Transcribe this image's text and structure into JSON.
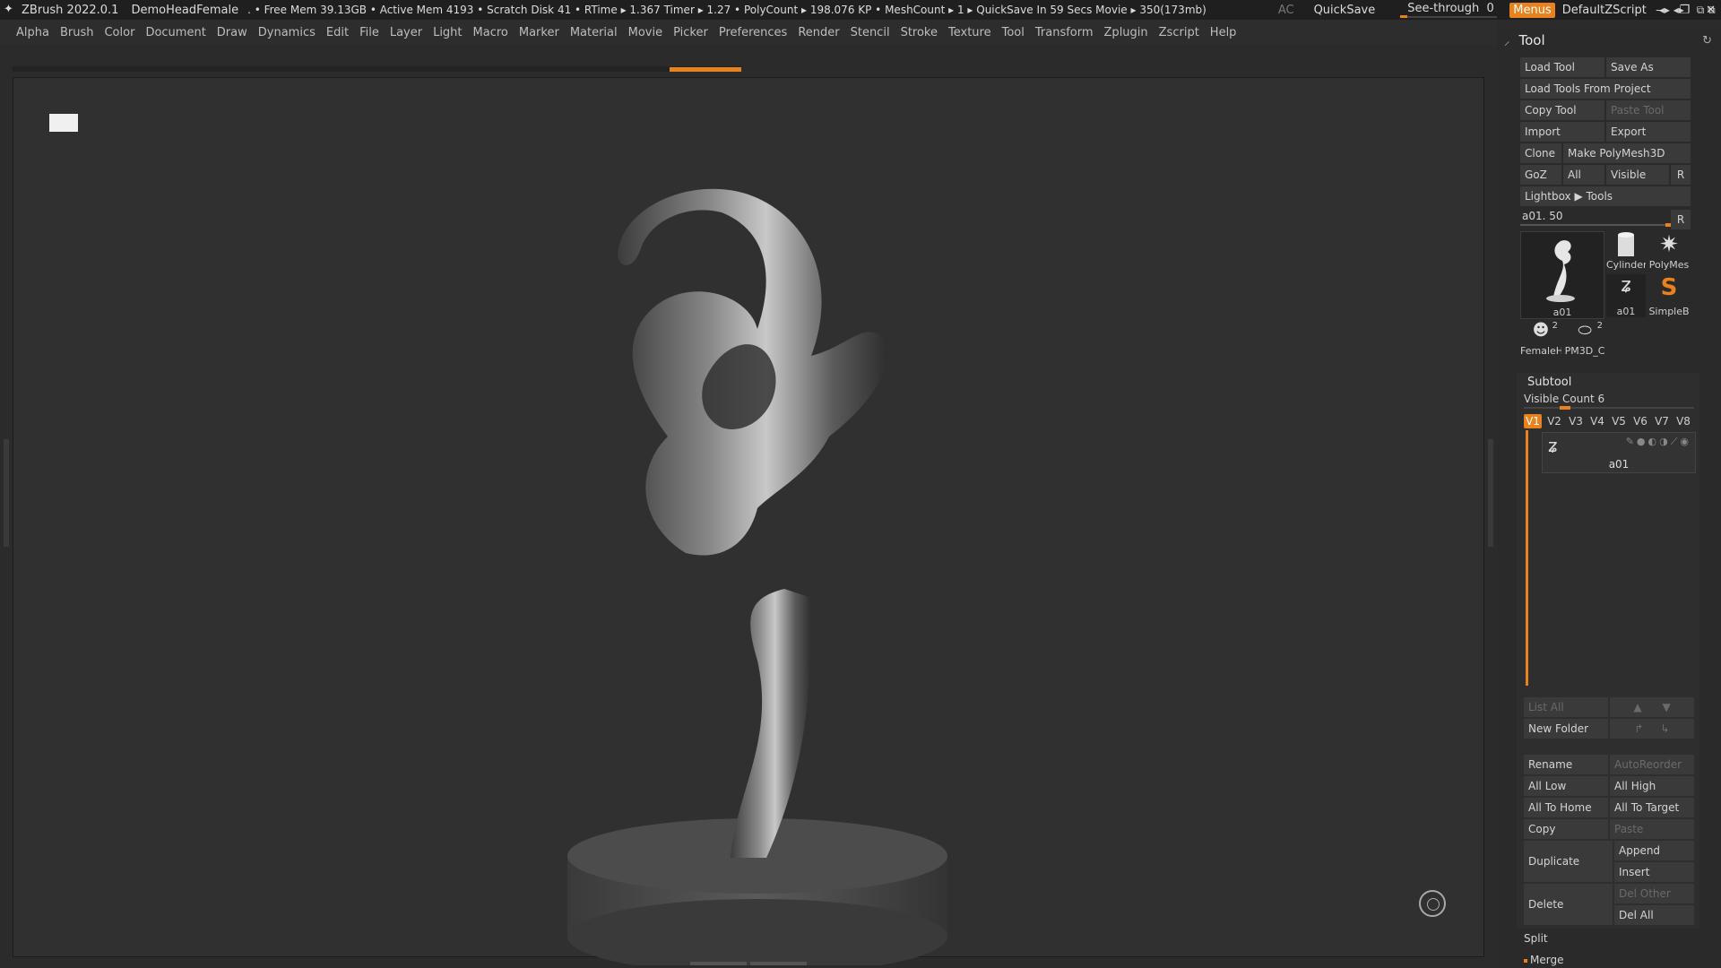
{
  "titlebar": {
    "app": "ZBrush 2022.0.1",
    "document": "DemoHeadFemale",
    "stats": ". • Free Mem 39.13GB • Active Mem 4193 • Scratch Disk 41 •  RTime ▸ 1.367 Timer ▸ 1.27 • PolyCount ▸ 198.076 KP  • MeshCount ▸ 1  ▸ QuickSave In 59 Secs Movie ▸ 350(173mb)",
    "ac": "AC",
    "quicksave": "QuickSave",
    "see_through_label": "See-through",
    "see_through_value": "0",
    "menus": "Menus",
    "default_zscript": "DefaultZScript"
  },
  "menubar": [
    "Alpha",
    "Brush",
    "Color",
    "Document",
    "Draw",
    "Dynamics",
    "Edit",
    "File",
    "Layer",
    "Light",
    "Macro",
    "Marker",
    "Material",
    "Movie",
    "Picker",
    "Preferences",
    "Render",
    "Stencil",
    "Stroke",
    "Texture",
    "Tool",
    "Transform",
    "Zplugin",
    "Zscript",
    "Help"
  ],
  "tool_panel": {
    "title": "Tool",
    "load_tool": "Load Tool",
    "save_as": "Save As",
    "load_from_project": "Load Tools From Project",
    "copy_tool": "Copy Tool",
    "paste_tool": "Paste Tool",
    "import": "Import",
    "export": "Export",
    "clone": "Clone",
    "make_polymesh": "Make PolyMesh3D",
    "goz": "GoZ",
    "all": "All",
    "visible": "Visible",
    "r": "R",
    "lightbox": "Lightbox ▶ Tools",
    "slider_label": "a01. 50",
    "thumbs": {
      "a01_big": "a01",
      "cylinder": "Cylinder",
      "polymesh": "PolyMes",
      "a01_small": "a01",
      "simpleb": "SimpleB",
      "female": "FemaleH",
      "female_count": "2",
      "pm3d": "PM3D_C",
      "pm3d_count": "2"
    }
  },
  "subtool": {
    "title": "Subtool",
    "visible_count": "Visible Count 6",
    "versions": [
      "V1",
      "V2",
      "V3",
      "V4",
      "V5",
      "V6",
      "V7",
      "V8"
    ],
    "item_name": "a01",
    "list_all": "List All",
    "new_folder": "New Folder",
    "rename": "Rename",
    "auto_reorder": "AutoReorder",
    "all_low": "All Low",
    "all_high": "All High",
    "all_to_home": "All To Home",
    "all_to_target": "All To Target",
    "copy": "Copy",
    "paste": "Paste",
    "duplicate": "Duplicate",
    "append": "Append",
    "insert": "Insert",
    "delete": "Delete",
    "del_other": "Del Other",
    "del_all": "Del All",
    "split": "Split",
    "merge": "Merge"
  },
  "icons": [
    "zbrush-logo-icon",
    "brush-icon",
    "refresh-icon",
    "eye-icon",
    "arrow-up-icon",
    "arrow-down-icon",
    "view-gizmo-icon"
  ],
  "colors": {
    "accent": "#e8821e",
    "panel": "#2a2a2a",
    "viewport": "#303030"
  }
}
